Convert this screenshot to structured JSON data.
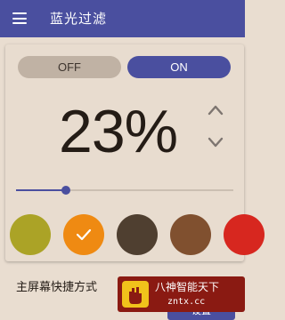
{
  "app": {
    "title": "蓝光过滤"
  },
  "toggle": {
    "off_label": "OFF",
    "on_label": "ON",
    "state": "on"
  },
  "intensity": {
    "value": "23",
    "unit": "%",
    "slider_fraction": 0.23
  },
  "swatches": [
    {
      "color": "#aba326",
      "selected": false
    },
    {
      "color": "#ef8a12",
      "selected": true
    },
    {
      "color": "#4f3f30",
      "selected": false
    },
    {
      "color": "#80502f",
      "selected": false
    },
    {
      "color": "#d7271f",
      "selected": false
    }
  ],
  "shortcut": {
    "label": "主屏幕快捷方式",
    "button_label": "设置"
  },
  "watermark": {
    "text": "八神智能天下",
    "url": "zntx.cc"
  },
  "colors": {
    "accent": "#4a4f9f",
    "background": "#e9ddd0",
    "toggle_off": "#c0b2a4"
  }
}
